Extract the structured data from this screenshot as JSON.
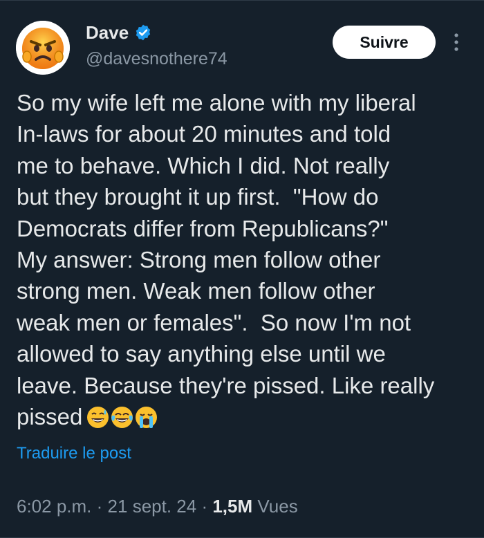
{
  "user": {
    "display_name": "Dave",
    "handle": "@davesnothere74",
    "verified": true,
    "avatar_icon": "angry-face-emoji-icon"
  },
  "actions": {
    "follow_label": "Suivre",
    "more_icon": "more-vertical-icon"
  },
  "tweet": {
    "text": "So my wife left me alone with my liberal\nIn-laws for about 20 minutes and told\nme to behave. Which I did. Not really\nbut they brought it up first.  \"How do\nDemocrats differ from Republicans?\"\nMy answer: Strong men follow other\nstrong men. Weak men follow other\nweak men or females\".  So now I'm not\nallowed to say anything else until we\nleave. Because they're pissed. Like really\npissed",
    "emojis": [
      "grinning-sweat-emoji-icon",
      "tears-of-joy-emoji-icon",
      "crying-emoji-icon"
    ]
  },
  "translate_label": "Traduire le post",
  "meta": {
    "time": "6:02 p.m.",
    "separator": "·",
    "date": "21 sept. 24",
    "views_count": "1,5M",
    "views_label": "Vues"
  },
  "colors": {
    "background": "#15202b",
    "text": "#e7e9ea",
    "muted": "#8b98a5",
    "accent": "#1d9bf0",
    "verified": "#1d9bf0"
  }
}
